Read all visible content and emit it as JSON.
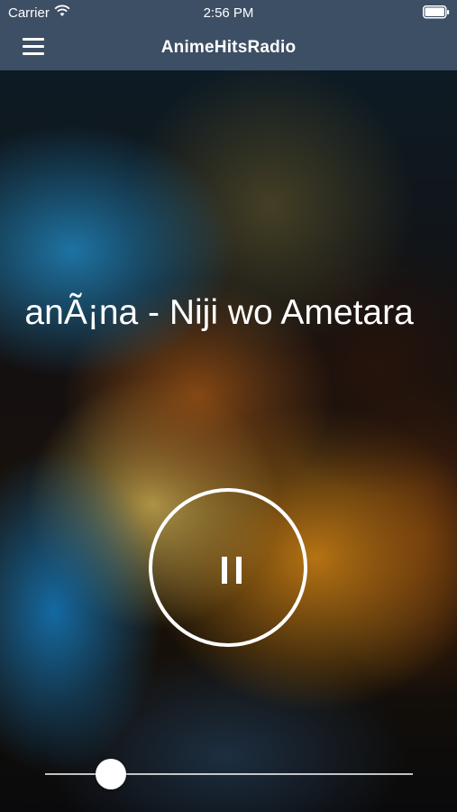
{
  "status_bar": {
    "carrier": "Carrier",
    "time": "2:56 PM",
    "wifi_icon": "wifi-icon",
    "battery_icon": "battery-icon"
  },
  "nav": {
    "title": "AnimeHitsRadio",
    "menu_icon": "hamburger-menu-icon",
    "bar_color": "#3d4f64"
  },
  "player": {
    "track_title": "Shiena NanÃ¡na - Niji wo Ametara",
    "state": "playing",
    "control_icon": "pause-icon",
    "volume": 0.18
  }
}
